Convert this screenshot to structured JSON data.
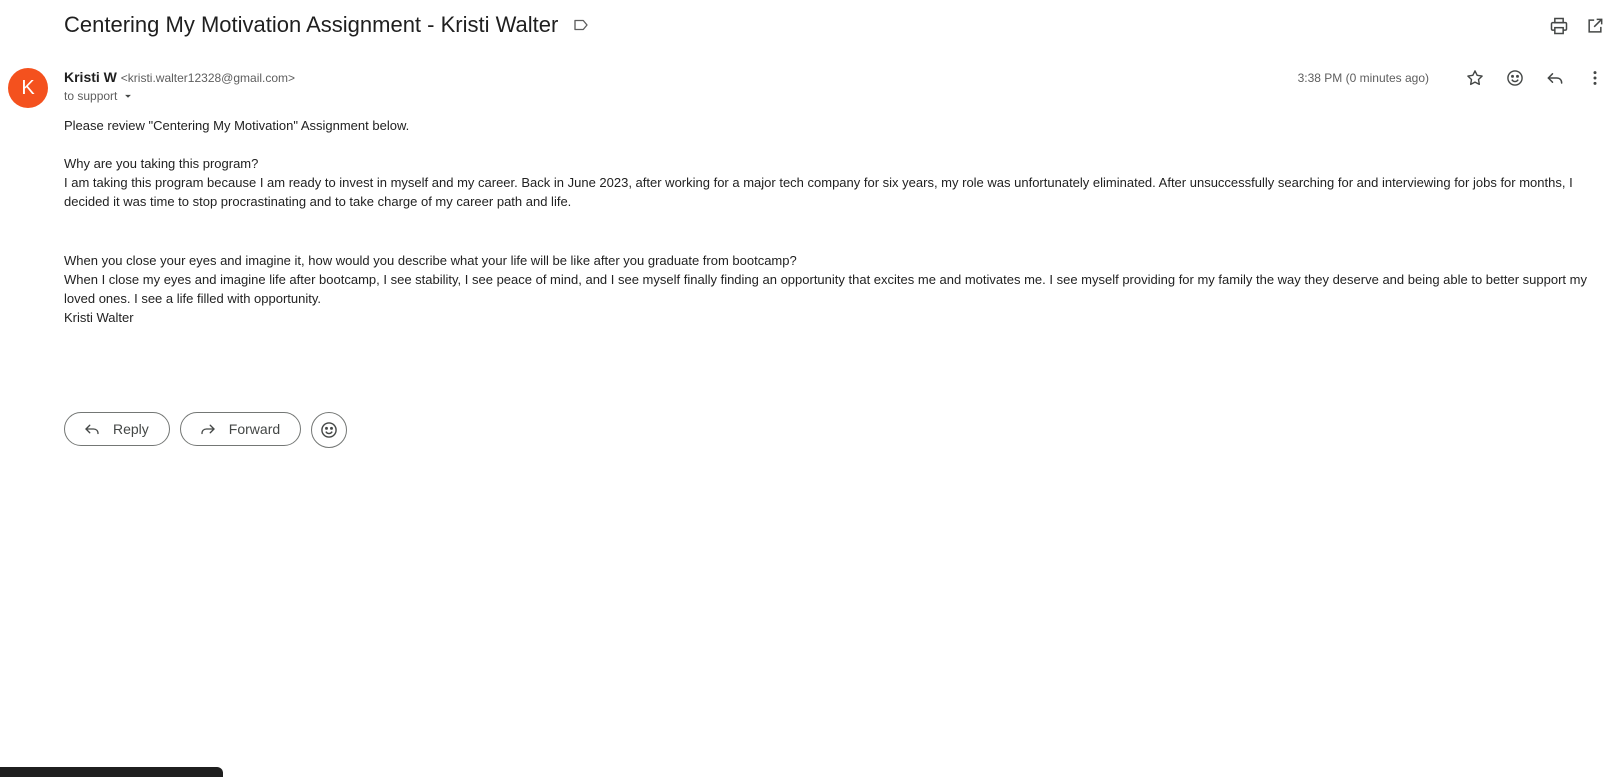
{
  "email": {
    "subject": "Centering My Motivation Assignment - Kristi Walter",
    "sender_initial": "K",
    "sender_name": "Kristi W",
    "sender_email": "<kristi.walter12328@gmail.com>",
    "recipient_label": "to support",
    "timestamp": "3:38 PM (0 minutes ago)",
    "body": {
      "intro": "Please review \"Centering My Motivation\" Assignment below.",
      "q1": "Why are you taking this program?",
      "a1": "I am taking this program because I am ready to invest in myself and my career. Back in June 2023, after working for a major tech company for six years, my role was unfortunately eliminated. After unsuccessfully searching for and interviewing for jobs for months, I decided it was time to stop procrastinating and to take charge of my career path and life.",
      "q2": "When you close your eyes and imagine it, how would you describe what your life will be like after you graduate from bootcamp?",
      "a2": "When I close my eyes and imagine life after bootcamp,  I see stability, I see peace of mind, and I see myself finally finding an opportunity that excites me and motivates me. I see myself providing for my family the way they deserve and being able to better support my loved ones. I see a life filled with opportunity.",
      "signature": "Kristi Walter"
    }
  },
  "actions": {
    "reply_label": "Reply",
    "forward_label": "Forward"
  },
  "icons": {
    "top": [
      "print-icon",
      "open-in-new-window-icon"
    ],
    "meta": [
      "star-icon",
      "emoji-reaction-icon",
      "reply-icon",
      "more-vertical-icon"
    ],
    "label": "label-outline-icon"
  },
  "colors": {
    "avatar_bg": "#f4511e",
    "icon": "#444746"
  }
}
